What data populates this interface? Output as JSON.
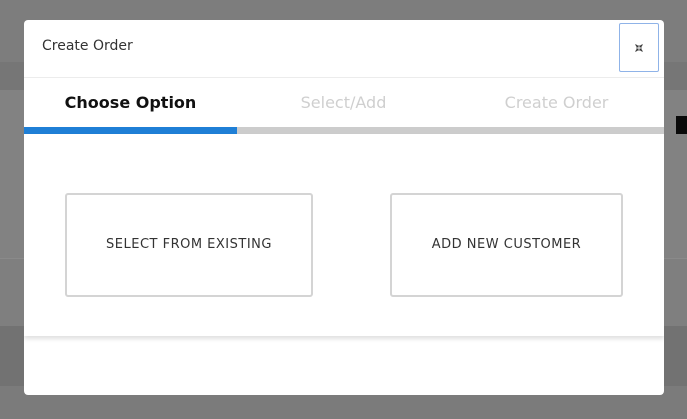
{
  "modal": {
    "title": "Create Order",
    "close_icon": "collapse-arrows-icon"
  },
  "stepper": {
    "steps": [
      {
        "label": "Choose Option",
        "state": "active"
      },
      {
        "label": "Select/Add",
        "state": "inactive"
      },
      {
        "label": "Create Order",
        "state": "inactive"
      }
    ],
    "progress_fraction": 0.333,
    "colors": {
      "active": "#1f7fd6",
      "track": "#cccccc",
      "inactive_text": "#cfcfcf"
    }
  },
  "options": [
    {
      "label": "SELECT FROM EXISTING"
    },
    {
      "label": "ADD NEW CUSTOMER"
    }
  ]
}
